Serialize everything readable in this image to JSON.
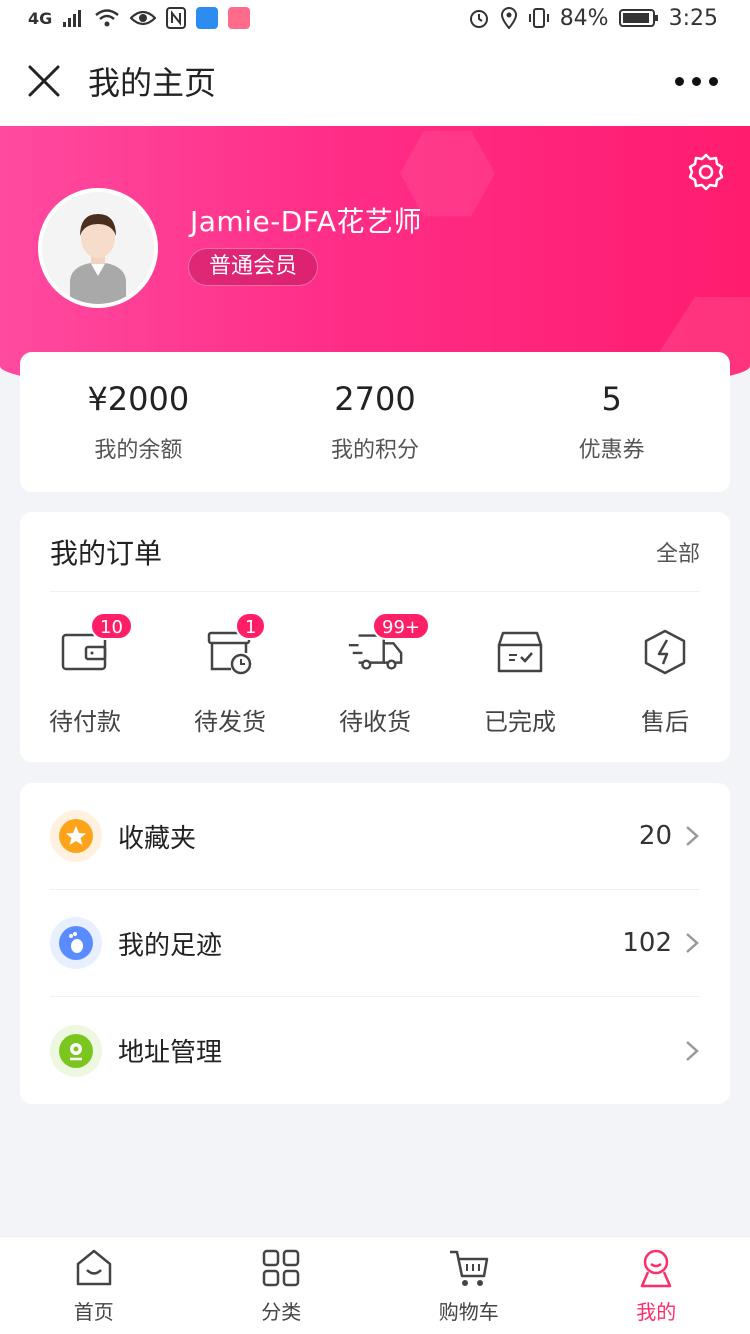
{
  "status_bar": {
    "network": "4G",
    "battery": "84%",
    "time": "3:25"
  },
  "nav": {
    "title": "我的主页"
  },
  "profile": {
    "username": "Jamie-DFA花艺师",
    "member_level": "普通会员"
  },
  "stats": [
    {
      "value": "¥2000",
      "label": "我的余额"
    },
    {
      "value": "2700",
      "label": "我的积分"
    },
    {
      "value": "5",
      "label": "优惠券"
    }
  ],
  "orders": {
    "title": "我的订单",
    "all_label": "全部",
    "items": [
      {
        "label": "待付款",
        "badge": "10",
        "icon": "wallet-icon"
      },
      {
        "label": "待发货",
        "badge": "1",
        "icon": "package-clock-icon"
      },
      {
        "label": "待收货",
        "badge": "99+",
        "icon": "truck-icon"
      },
      {
        "label": "已完成",
        "badge": "",
        "icon": "box-check-icon"
      },
      {
        "label": "售后",
        "badge": "",
        "icon": "lightning-hex-icon"
      }
    ]
  },
  "menu": [
    {
      "label": "收藏夹",
      "count": "20",
      "icon": "star-icon",
      "color": "#ffa31a"
    },
    {
      "label": "我的足迹",
      "count": "102",
      "icon": "footprint-icon",
      "color": "#5b8cff"
    },
    {
      "label": "地址管理",
      "count": "",
      "icon": "location-icon",
      "color": "#7bc61e"
    }
  ],
  "tabs": [
    {
      "label": "首页",
      "icon": "home-icon"
    },
    {
      "label": "分类",
      "icon": "grid-icon"
    },
    {
      "label": "购物车",
      "icon": "cart-icon"
    },
    {
      "label": "我的",
      "icon": "profile-icon"
    }
  ],
  "colors": {
    "brand": "#ff2d87",
    "accent_badge": "#ff1f67",
    "active_tab": "#ff2d68"
  }
}
